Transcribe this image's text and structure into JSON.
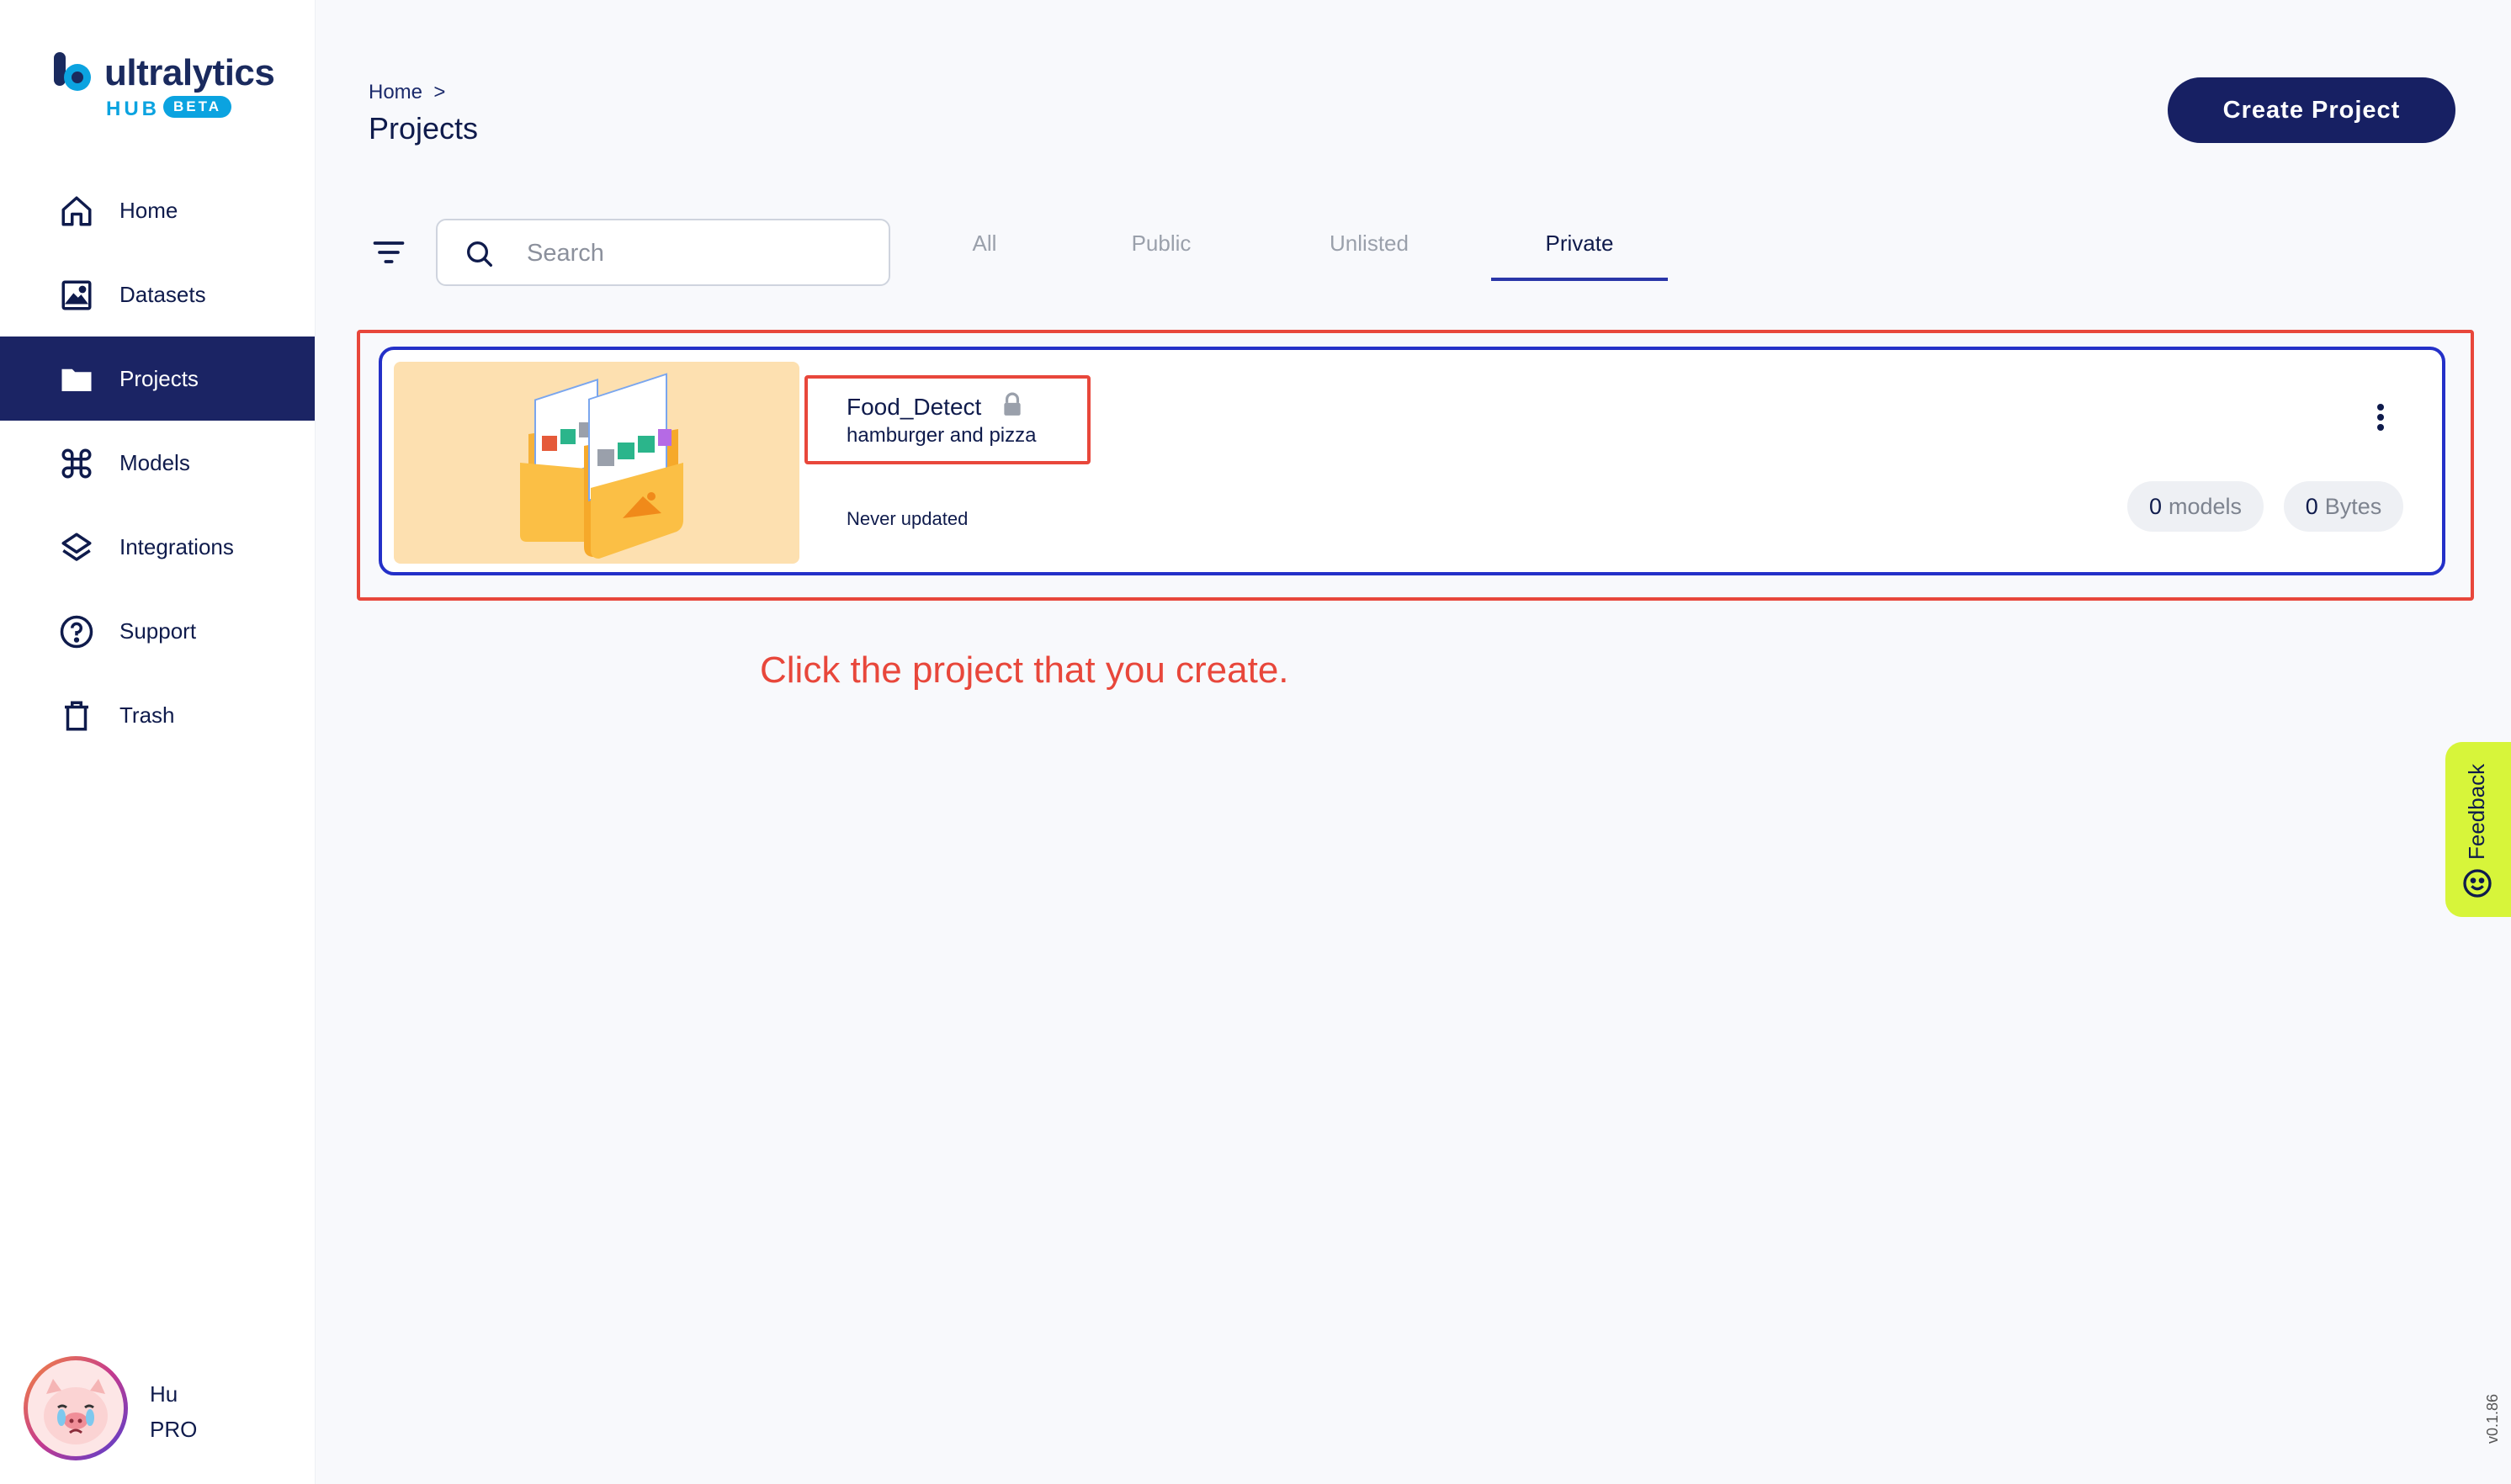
{
  "brand": {
    "name": "ultralytics",
    "hub": "HUB",
    "beta": "BETA"
  },
  "sidebar": {
    "items": [
      {
        "label": "Home",
        "icon": "home-icon"
      },
      {
        "label": "Datasets",
        "icon": "image-icon"
      },
      {
        "label": "Projects",
        "icon": "folder-icon",
        "active": true
      },
      {
        "label": "Models",
        "icon": "command-icon"
      },
      {
        "label": "Integrations",
        "icon": "layers-icon"
      },
      {
        "label": "Support",
        "icon": "help-circle-icon"
      },
      {
        "label": "Trash",
        "icon": "trash-icon"
      }
    ],
    "user": {
      "name": "Hu",
      "plan": "PRO"
    }
  },
  "header": {
    "breadcrumb": "Home  >",
    "title": "Projects",
    "create_label": "Create Project"
  },
  "toolbar": {
    "search_placeholder": "Search",
    "tabs": [
      {
        "label": "All"
      },
      {
        "label": "Public"
      },
      {
        "label": "Unlisted"
      },
      {
        "label": "Private",
        "active": true
      }
    ]
  },
  "project": {
    "name": "Food_Detect",
    "description": "hamburger and pizza",
    "updated": "Never updated",
    "models_count": "0",
    "models_label": "models",
    "size_value": "0",
    "size_unit": "Bytes"
  },
  "annotation": "Click the project that you create.",
  "feedback_label": "Feedback",
  "version": "v0.1.86",
  "colors": {
    "primary": "#1b2464",
    "accent": "#2430c8",
    "highlight": "#e8473b",
    "feedback": "#d7f53a",
    "beta": "#0ba3e0"
  }
}
